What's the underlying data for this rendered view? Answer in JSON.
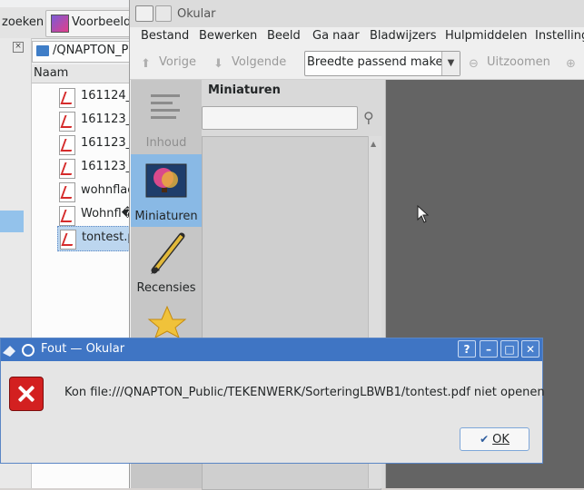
{
  "dolphin": {
    "toolbar": {
      "search_label": "zoeken",
      "preview_label": "Voorbeeld"
    },
    "location": "/QNAPTON_P",
    "column_header": "Naam",
    "files": [
      {
        "name": "161124_"
      },
      {
        "name": "161123_"
      },
      {
        "name": "161123_"
      },
      {
        "name": "161123_"
      },
      {
        "name": "wohnflac"
      },
      {
        "name": "Wohnfl�"
      },
      {
        "name": "tontest.p"
      }
    ]
  },
  "okular": {
    "title": "Okular",
    "menu": [
      "Bestand",
      "Bewerken",
      "Beeld",
      "Ga naar",
      "Bladwijzers",
      "Hulpmiddelen",
      "Instelling"
    ],
    "toolbar": {
      "prev_label": "Vorige",
      "next_label": "Volgende",
      "zoom_mode": "Breedte passend maken",
      "zoom_out_label": "Uitzoomen"
    },
    "sidebar": [
      {
        "label": "Inhoud"
      },
      {
        "label": "Miniaturen"
      },
      {
        "label": "Recensies"
      }
    ],
    "panel_title": "Miniaturen"
  },
  "dialog": {
    "title": "Fout — Okular",
    "message": "Kon file:///QNAPTON_Public/TEKENWERK/SorteringLBWB1/tontest.pdf niet openen",
    "ok_label": "OK"
  },
  "colors": {
    "dialog_titlebar": "#3f75c4",
    "selection": "#89b9e5",
    "document_view": "#646464"
  }
}
